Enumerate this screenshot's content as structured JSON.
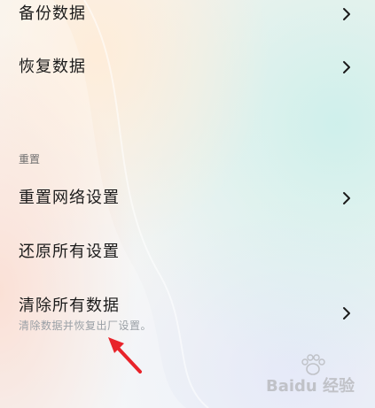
{
  "settings": {
    "items": [
      {
        "label": "备份数据"
      },
      {
        "label": "恢复数据"
      }
    ],
    "reset_section": {
      "label": "重置",
      "items": [
        {
          "label": "重置网络设置"
        },
        {
          "label": "还原所有设置"
        },
        {
          "label": "清除所有数据",
          "description": "清除数据并恢复出厂设置。"
        }
      ]
    }
  },
  "watermark": {
    "text": "Baidu 经验"
  },
  "colors": {
    "annotation_arrow": "#e8232a",
    "text_primary": "#1b1b1b",
    "text_secondary": "#9aa0a6"
  },
  "icons": {
    "row_chevron": "chevron-right-icon",
    "annotation": "red-arrow-icon",
    "watermark": "paw-icon"
  }
}
